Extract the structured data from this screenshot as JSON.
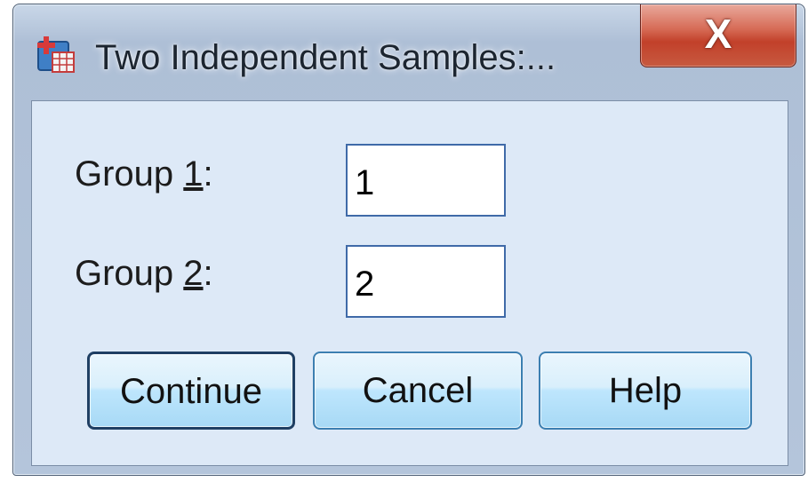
{
  "window": {
    "title": "Two Independent Samples:...",
    "close_label": "X"
  },
  "groups": [
    {
      "label_prefix": "Group ",
      "label_mnemonic": "1",
      "label_suffix": ":",
      "value": "1"
    },
    {
      "label_prefix": "Group ",
      "label_mnemonic": "2",
      "label_suffix": ":",
      "value": "2"
    }
  ],
  "buttons": {
    "continue_label": "Continue",
    "cancel_label": "Cancel",
    "help_label": "Help"
  },
  "icons": {
    "app": "spss-dialog-icon",
    "close": "close-icon"
  },
  "colors": {
    "client_background": "#dde9f7",
    "button_border": "#3c7fb1",
    "close_button": "#c2402a",
    "field_border": "#3f6aa8"
  }
}
